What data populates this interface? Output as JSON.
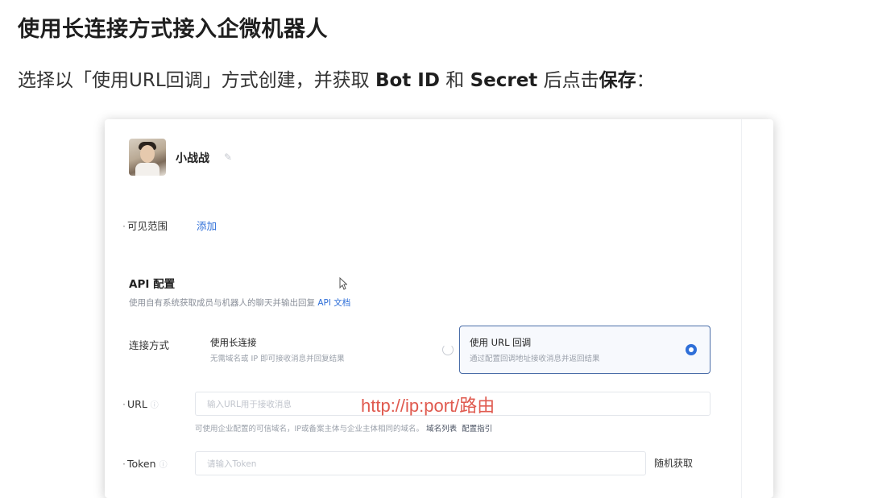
{
  "heading": "使用长连接方式接入企微机器人",
  "instruction": {
    "part1": "选择以「使用URL回调」方式创建，并获取 ",
    "bot_id": "Bot ID",
    "and": " 和 ",
    "secret": "Secret",
    "part2": " 后点击",
    "save": "保存",
    "end": "："
  },
  "card": {
    "bot_name": "小战战",
    "visible_range_label": "可见范围",
    "visible_range_action": "添加",
    "api_title": "API 配置",
    "api_desc": "使用自有系统获取成员与机器人的聊天并输出回复",
    "api_doc_link": "API 文档",
    "connection_label": "连接方式",
    "options": [
      {
        "title": "使用长连接",
        "desc": "无需域名或 IP 即可接收消息并回复结果",
        "selected": false
      },
      {
        "title": "使用 URL 回调",
        "desc": "通过配置回调地址接收消息并返回结果",
        "selected": true
      }
    ],
    "url_label": "URL",
    "url_placeholder": "输入URL用于接收消息",
    "url_overlay": "http://ip:port/路由",
    "url_hint": "可使用企业配置的可信域名，IP或备案主体与企业主体相同的域名。",
    "url_hint_link1": "域名列表",
    "url_hint_link2": "配置指引",
    "token_label": "Token",
    "token_placeholder": "请输入Token",
    "random_button": "随机获取"
  },
  "colors": {
    "accent": "#2f6fd8",
    "selected_border": "#4a6da8",
    "overlay_red": "#e05a4f"
  }
}
